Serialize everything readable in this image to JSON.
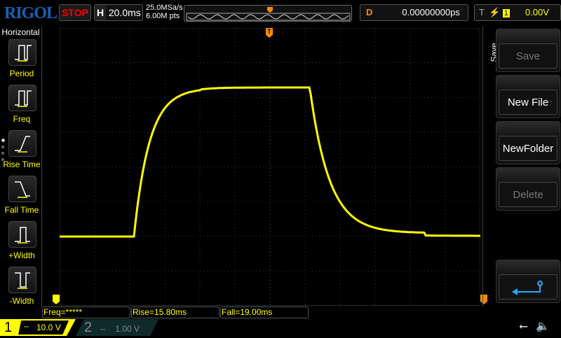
{
  "header": {
    "brand": "RIGOL",
    "run_state": "STOP",
    "timebase_label": "H",
    "timebase": "20.0ms",
    "sample_rate": "25.0MSa/s",
    "memory_depth": "6.00M pts",
    "delay_label": "D",
    "delay": "0.00000000ps",
    "trigger_label": "T",
    "trigger_source": "1",
    "trigger_level": "0.00V"
  },
  "left_menu": {
    "title": "Horizontal",
    "items": [
      {
        "label": "Period",
        "icon": "period-icon"
      },
      {
        "label": "Freq",
        "icon": "freq-icon"
      },
      {
        "label": "Rise Time",
        "icon": "rise-time-icon"
      },
      {
        "label": "Fall Time",
        "icon": "fall-time-icon"
      },
      {
        "label": "+Width",
        "icon": "positive-width-icon"
      },
      {
        "label": "-Width",
        "icon": "negative-width-icon"
      }
    ]
  },
  "right_menu": {
    "title": "Save",
    "buttons": [
      {
        "label": "Save",
        "enabled": false
      },
      {
        "label": "New File",
        "enabled": true
      },
      {
        "label": "NewFolder",
        "enabled": true
      },
      {
        "label": "Delete",
        "enabled": false
      }
    ],
    "back_icon": "return-arrow-icon"
  },
  "measurements": [
    "Freq=*****",
    "Rise=15.80ms",
    "Fall=19.00ms"
  ],
  "channels": [
    {
      "number": "1",
      "scale": "10.0 V",
      "coupling": "DC",
      "color": "#ffff00",
      "active": true
    },
    {
      "number": "2",
      "scale": "1.00 V",
      "coupling": "DC",
      "color": "#00c0c0",
      "active": false
    }
  ],
  "status_icons": [
    "usb-icon",
    "speaker-muted-icon"
  ],
  "colors": {
    "ch1": "#ffff00",
    "trigger": "#ff8c00",
    "brand": "#1a5fb4",
    "stop": "#ff0000",
    "accent": "#00a0ff"
  }
}
